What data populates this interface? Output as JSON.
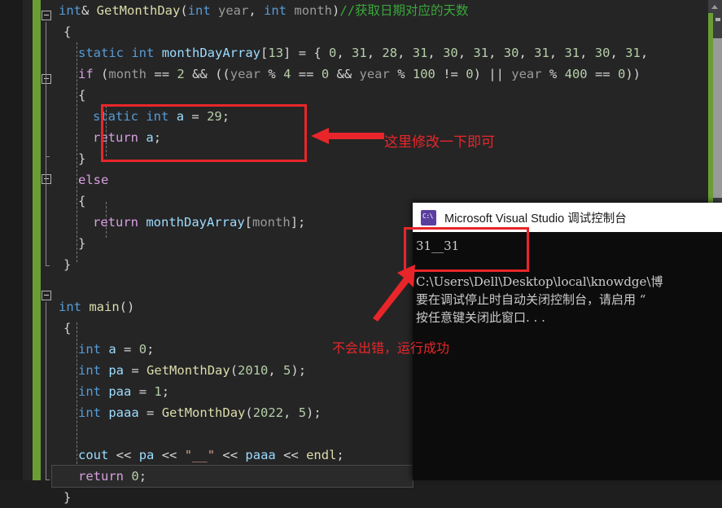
{
  "editor": {
    "name": "visual-studio-code-editor",
    "theme_bg": "#252526",
    "change_bar_color": "#6a9e35",
    "lines": [
      {
        "id": "l1",
        "text": "int& GetMonthDay(int year, int month)//获取日期对应的天数"
      },
      {
        "id": "l2",
        "text": "{"
      },
      {
        "id": "l3",
        "text": "    static int monthDayArray[13] = { 0, 31, 28, 31, 30, 31, 30, 31, 31, 30, 31,"
      },
      {
        "id": "l4",
        "text": "    if (month == 2 && ((year % 4 == 0 && year % 100 != 0) || year % 400 == 0))"
      },
      {
        "id": "l5",
        "text": "    {"
      },
      {
        "id": "l6",
        "text": "        static int a = 29;"
      },
      {
        "id": "l7",
        "text": "        return a;"
      },
      {
        "id": "l8",
        "text": "    }"
      },
      {
        "id": "l9",
        "text": "    else"
      },
      {
        "id": "l10",
        "text": "    {"
      },
      {
        "id": "l11",
        "text": "        return monthDayArray[month];"
      },
      {
        "id": "l12",
        "text": "    }"
      },
      {
        "id": "l13",
        "text": "}"
      },
      {
        "id": "l14",
        "text": ""
      },
      {
        "id": "l15",
        "text": "int main()"
      },
      {
        "id": "l16",
        "text": "{"
      },
      {
        "id": "l17",
        "text": "    int a = 0;"
      },
      {
        "id": "l18",
        "text": "    int pa = GetMonthDay(2010, 5);"
      },
      {
        "id": "l19",
        "text": "    int paa = 1;"
      },
      {
        "id": "l20",
        "text": "    int paaa = GetMonthDay(2022, 5);"
      },
      {
        "id": "l21",
        "text": ""
      },
      {
        "id": "l22",
        "text": "    cout << pa << \"__\" << paaa << endl;"
      },
      {
        "id": "l23",
        "text": "    return 0;"
      },
      {
        "id": "l24",
        "text": "}"
      }
    ],
    "tokens": {
      "kw_int": "int",
      "kw_static": "static",
      "kw_return": "return",
      "kw_if": "if",
      "kw_else": "else",
      "fn_getmonthday": "GetMonthDay",
      "fn_main": "main",
      "comment_line1": "//获取日期对应的天数"
    }
  },
  "console": {
    "name": "vs-debug-console",
    "title": "Microsoft Visual Studio 调试控制台",
    "icon": "console-app-icon",
    "lines": [
      "31__31",
      "",
      "C:\\Users\\Dell\\Desktop\\local\\knowdge\\博",
      "要在调试停止时自动关闭控制台，请启用 “",
      "按任意键关闭此窗口. . ."
    ]
  },
  "annotations": {
    "accent_color": "#e8262a",
    "box_code_label": "highlight-modified-code",
    "box_output_label": "highlight-console-output",
    "text_edit": "这里修改一下即可",
    "text_ok": "不会出错，运行成功",
    "arrow_left": "arrow-pointing-left",
    "arrow_diagonal": "arrow-pointing-up-right"
  },
  "scrollbar": {
    "name": "vertical-scrollbar",
    "up_arrow": "scroll-up-arrow",
    "thumb": "scroll-thumb",
    "change_marker_color": "#6a9e35"
  }
}
